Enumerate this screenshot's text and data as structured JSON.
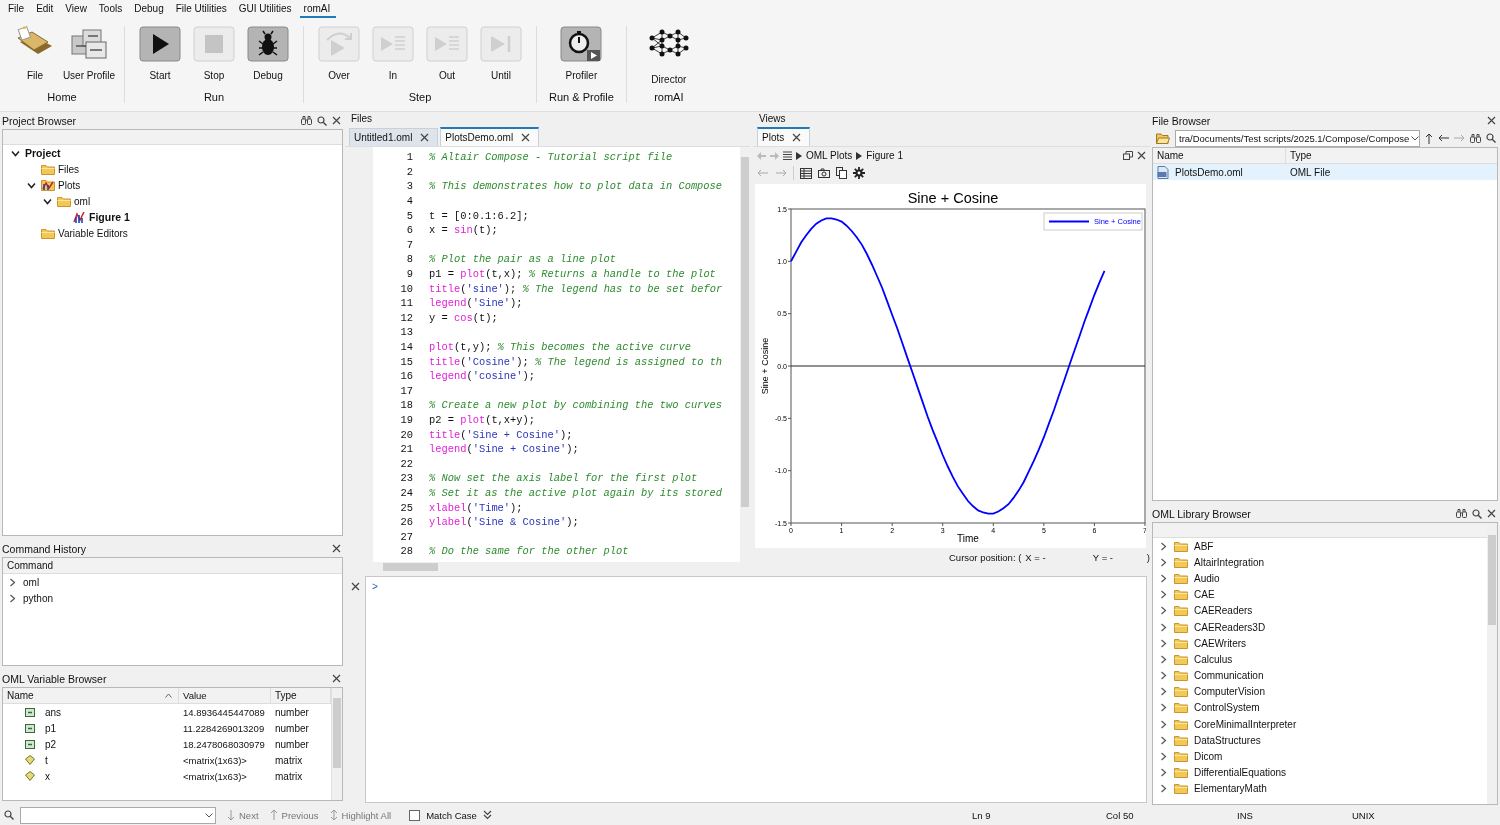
{
  "menu": [
    {
      "label": "File",
      "selected": false
    },
    {
      "label": "Edit",
      "selected": false
    },
    {
      "label": "View",
      "selected": false
    },
    {
      "label": "Tools",
      "selected": false
    },
    {
      "label": "Debug",
      "selected": false
    },
    {
      "label": "File Utilities",
      "selected": false
    },
    {
      "label": "GUI Utilities",
      "selected": false
    },
    {
      "label": "romAI",
      "selected": true
    }
  ],
  "ribbon": [
    {
      "label": "Home",
      "buttons": [
        {
          "label": "File",
          "kind": "file",
          "disabled": false
        },
        {
          "label": "User Profile",
          "kind": "profile",
          "disabled": false
        }
      ]
    },
    {
      "label": "Run",
      "buttons": [
        {
          "label": "Start",
          "kind": "start",
          "disabled": false
        },
        {
          "label": "Stop",
          "kind": "stop",
          "disabled": true
        },
        {
          "label": "Debug",
          "kind": "debug",
          "disabled": false
        }
      ]
    },
    {
      "label": "Step",
      "buttons": [
        {
          "label": "Over",
          "kind": "over",
          "disabled": true
        },
        {
          "label": "In",
          "kind": "in",
          "disabled": true
        },
        {
          "label": "Out",
          "kind": "out",
          "disabled": true
        },
        {
          "label": "Until",
          "kind": "until",
          "disabled": true
        }
      ]
    },
    {
      "label": "Run & Profile",
      "buttons": [
        {
          "label": "Profiler",
          "kind": "profiler",
          "disabled": false
        }
      ]
    },
    {
      "label": "romAI",
      "buttons": [
        {
          "label": "Director",
          "kind": "director",
          "disabled": false
        }
      ]
    }
  ],
  "project_browser": {
    "title": "Project Browser",
    "tree": [
      {
        "label": "Project",
        "kind": "root",
        "expanded": true,
        "children": [
          {
            "label": "Files",
            "kind": "folder"
          },
          {
            "label": "Plots",
            "kind": "plots",
            "expanded": true,
            "children": [
              {
                "label": "oml",
                "kind": "folder",
                "expanded": true,
                "children": [
                  {
                    "label": "Figure 1",
                    "kind": "figure"
                  }
                ]
              }
            ]
          },
          {
            "label": "Variable Editors",
            "kind": "folder"
          }
        ]
      }
    ]
  },
  "command_history": {
    "title": "Command History",
    "column": "Command",
    "items": [
      {
        "label": "oml",
        "expanded": false
      },
      {
        "label": "python",
        "expanded": false
      }
    ]
  },
  "variable_browser": {
    "title": "OML Variable Browser",
    "columns": [
      "Name",
      "Value",
      "Type"
    ],
    "rows": [
      {
        "name": "ans",
        "value": "14.8936445447089",
        "type": "number",
        "kind": "number"
      },
      {
        "name": "p1",
        "value": "11.2284269013209",
        "type": "number",
        "kind": "number"
      },
      {
        "name": "p2",
        "value": "18.2478068030979",
        "type": "number",
        "kind": "number"
      },
      {
        "name": "t",
        "value": "<matrix(1x63)>",
        "type": "matrix",
        "kind": "matrix"
      },
      {
        "name": "x",
        "value": "<matrix(1x63)>",
        "type": "matrix",
        "kind": "matrix"
      }
    ]
  },
  "editor": {
    "title": "Files",
    "tabs": [
      {
        "label": "Untitled1.oml",
        "selected": false
      },
      {
        "label": "PlotsDemo.oml",
        "selected": true
      }
    ],
    "lines": [
      {
        "number": "1",
        "segments": [
          {
            "text": "% Altair Compose - Tutorial script file",
            "kind": "comment"
          }
        ]
      },
      {
        "number": "2"
      },
      {
        "number": "3",
        "segments": [
          {
            "text": "% This demonstrates how to plot data in Compose",
            "kind": "comment"
          }
        ]
      },
      {
        "number": "4"
      },
      {
        "number": "5",
        "segments": [
          {
            "text": "t = [0:0.1:6.2];",
            "kind": "plain"
          }
        ]
      },
      {
        "number": "6",
        "segments": [
          {
            "text": "x = ",
            "kind": "plain"
          },
          {
            "text": "sin",
            "kind": "function"
          },
          {
            "text": "(t);",
            "kind": "plain"
          }
        ]
      },
      {
        "number": "7"
      },
      {
        "number": "8",
        "segments": [
          {
            "text": "% Plot the pair as a line plot",
            "kind": "comment"
          }
        ]
      },
      {
        "number": "9",
        "segments": [
          {
            "text": "p1 = ",
            "kind": "plain"
          },
          {
            "text": "plot",
            "kind": "function"
          },
          {
            "text": "(t,x); ",
            "kind": "plain"
          },
          {
            "text": "% Returns a handle to the plot",
            "kind": "comment"
          }
        ]
      },
      {
        "number": "10",
        "segments": [
          {
            "text": "title",
            "kind": "function"
          },
          {
            "text": "(",
            "kind": "plain"
          },
          {
            "text": "'sine'",
            "kind": "string"
          },
          {
            "text": "); ",
            "kind": "plain"
          },
          {
            "text": "% The legend has to be set befor",
            "kind": "comment"
          }
        ]
      },
      {
        "number": "11",
        "segments": [
          {
            "text": "legend",
            "kind": "function"
          },
          {
            "text": "(",
            "kind": "plain"
          },
          {
            "text": "'Sine'",
            "kind": "string"
          },
          {
            "text": ");",
            "kind": "plain"
          }
        ]
      },
      {
        "number": "12",
        "segments": [
          {
            "text": "y = ",
            "kind": "plain"
          },
          {
            "text": "cos",
            "kind": "function"
          },
          {
            "text": "(t);",
            "kind": "plain"
          }
        ]
      },
      {
        "number": "13"
      },
      {
        "number": "14",
        "segments": [
          {
            "text": "plot",
            "kind": "function"
          },
          {
            "text": "(t,y); ",
            "kind": "plain"
          },
          {
            "text": "% This becomes the active curve",
            "kind": "comment"
          }
        ]
      },
      {
        "number": "15",
        "segments": [
          {
            "text": "title",
            "kind": "function"
          },
          {
            "text": "(",
            "kind": "plain"
          },
          {
            "text": "'Cosine'",
            "kind": "string"
          },
          {
            "text": "); ",
            "kind": "plain"
          },
          {
            "text": "% The legend is assigned to th",
            "kind": "comment"
          }
        ]
      },
      {
        "number": "16",
        "segments": [
          {
            "text": "legend",
            "kind": "function"
          },
          {
            "text": "(",
            "kind": "plain"
          },
          {
            "text": "'cosine'",
            "kind": "string"
          },
          {
            "text": ");",
            "kind": "plain"
          }
        ]
      },
      {
        "number": "17"
      },
      {
        "number": "18",
        "segments": [
          {
            "text": "% Create a new plot by combining the two curves",
            "kind": "comment"
          }
        ]
      },
      {
        "number": "19",
        "segments": [
          {
            "text": "p2 = ",
            "kind": "plain"
          },
          {
            "text": "plot",
            "kind": "function"
          },
          {
            "text": "(t,x+y);",
            "kind": "plain"
          }
        ]
      },
      {
        "number": "20",
        "segments": [
          {
            "text": "title",
            "kind": "function"
          },
          {
            "text": "(",
            "kind": "plain"
          },
          {
            "text": "'Sine + Cosine'",
            "kind": "string"
          },
          {
            "text": ");",
            "kind": "plain"
          }
        ]
      },
      {
        "number": "21",
        "segments": [
          {
            "text": "legend",
            "kind": "function"
          },
          {
            "text": "(",
            "kind": "plain"
          },
          {
            "text": "'Sine + Cosine'",
            "kind": "string"
          },
          {
            "text": ");",
            "kind": "plain"
          }
        ]
      },
      {
        "number": "22"
      },
      {
        "number": "23",
        "segments": [
          {
            "text": "% Now set the axis label for the first plot",
            "kind": "comment"
          }
        ]
      },
      {
        "number": "24",
        "segments": [
          {
            "text": "% Set it as the active plot again by its stored",
            "kind": "comment"
          }
        ]
      },
      {
        "number": "25",
        "segments": [
          {
            "text": "xlabel",
            "kind": "function"
          },
          {
            "text": "(",
            "kind": "plain"
          },
          {
            "text": "'Time'",
            "kind": "string"
          },
          {
            "text": ");",
            "kind": "plain"
          }
        ]
      },
      {
        "number": "26",
        "segments": [
          {
            "text": "ylabel",
            "kind": "function"
          },
          {
            "text": "(",
            "kind": "plain"
          },
          {
            "text": "'Sine & Cosine'",
            "kind": "string"
          },
          {
            "text": ");",
            "kind": "plain"
          }
        ]
      },
      {
        "number": "27"
      },
      {
        "number": "28",
        "segments": [
          {
            "text": "% Do the same for the other plot",
            "kind": "comment"
          }
        ]
      }
    ]
  },
  "views": {
    "title": "Views",
    "tabs": [
      {
        "label": "Plots",
        "selected": true
      }
    ],
    "breadcrumb": [
      "OML Plots",
      "Figure 1"
    ],
    "chart_data": {
      "type": "line",
      "title": "Sine + Cosine",
      "xlabel": "Time",
      "ylabel": "Sine + Cosine",
      "x": [
        0,
        0.1,
        0.2,
        0.3,
        0.4,
        0.5,
        0.6,
        0.7,
        0.8,
        0.9,
        1,
        1.1,
        1.2,
        1.3,
        1.4,
        1.5,
        1.6,
        1.7,
        1.8,
        1.9,
        2,
        2.1,
        2.2,
        2.3,
        2.4,
        2.5,
        2.6,
        2.7,
        2.8,
        2.9,
        3,
        3.1,
        3.2,
        3.3,
        3.4,
        3.5,
        3.6,
        3.7,
        3.8,
        3.9,
        4,
        4.1,
        4.2,
        4.3,
        4.4,
        4.5,
        4.6,
        4.7,
        4.8,
        4.9,
        5,
        5.1,
        5.2,
        5.3,
        5.4,
        5.5,
        5.6,
        5.7,
        5.8,
        5.9,
        6,
        6.1,
        6.2
      ],
      "series": [
        {
          "name": "Sine + Cosine",
          "color": "#0000ff",
          "values": [
            1,
            1.09,
            1.18,
            1.25,
            1.31,
            1.36,
            1.39,
            1.41,
            1.41,
            1.4,
            1.38,
            1.34,
            1.29,
            1.23,
            1.16,
            1.07,
            0.97,
            0.86,
            0.75,
            0.62,
            0.49,
            0.36,
            0.22,
            0.08,
            -0.06,
            -0.2,
            -0.34,
            -0.48,
            -0.61,
            -0.73,
            -0.85,
            -0.96,
            -1.06,
            -1.15,
            -1.22,
            -1.29,
            -1.34,
            -1.38,
            -1.4,
            -1.41,
            -1.41,
            -1.39,
            -1.36,
            -1.32,
            -1.26,
            -1.19,
            -1.11,
            -1.01,
            -0.91,
            -0.8,
            -0.68,
            -0.55,
            -0.42,
            -0.28,
            -0.14,
            0,
            0.14,
            0.28,
            0.42,
            0.55,
            0.68,
            0.8,
            0.91
          ]
        }
      ],
      "xlim": [
        0,
        7
      ],
      "ylim": [
        -1.5,
        1.5
      ],
      "xticks": [
        0,
        1,
        2,
        3,
        4,
        5,
        6,
        7
      ],
      "yticks": [
        {
          "value": -1.5,
          "label": "-1.5"
        },
        {
          "value": -1,
          "label": "-1.0"
        },
        {
          "value": -0.5,
          "label": "-0.5"
        },
        {
          "value": 0,
          "label": "0.0"
        },
        {
          "value": 0.5,
          "label": "0.5"
        },
        {
          "value": 1,
          "label": "1.0"
        },
        {
          "value": 1.5,
          "label": "1.5"
        }
      ]
    },
    "cursor": {
      "label": "Cursor position: (",
      "x": "X = -",
      "y": "Y = -",
      "end": ")"
    }
  },
  "console": {
    "prompt": ">"
  },
  "file_browser": {
    "title": "File Browser",
    "path": "tra/Documents/Test scripts/2025.1/Compose/Compose",
    "columns": [
      "Name",
      "Type"
    ],
    "rows": [
      {
        "name": "PlotsDemo.oml",
        "type": "OML File",
        "selected": true
      }
    ]
  },
  "library": {
    "title": "OML Library Browser",
    "items": [
      {
        "label": "ABF",
        "expanded": false
      },
      {
        "label": "AltairIntegration",
        "expanded": false
      },
      {
        "label": "Audio",
        "expanded": false
      },
      {
        "label": "CAE",
        "expanded": false
      },
      {
        "label": "CAEReaders",
        "expanded": false
      },
      {
        "label": "CAEReaders3D",
        "expanded": false
      },
      {
        "label": "CAEWriters",
        "expanded": false
      },
      {
        "label": "Calculus",
        "expanded": false
      },
      {
        "label": "Communication",
        "expanded": false
      },
      {
        "label": "ComputerVision",
        "expanded": false
      },
      {
        "label": "ControlSystem",
        "expanded": false
      },
      {
        "label": "CoreMinimalInterpreter",
        "expanded": false
      },
      {
        "label": "DataStructures",
        "expanded": false
      },
      {
        "label": "Dicom",
        "expanded": false
      },
      {
        "label": "DifferentialEquations",
        "expanded": false
      },
      {
        "label": "ElementaryMath",
        "expanded": false
      }
    ]
  },
  "find_bar": {
    "buttons": [
      {
        "label": "Next",
        "kind": "down",
        "disabled": true
      },
      {
        "label": "Previous",
        "kind": "up",
        "disabled": true
      },
      {
        "label": "Highlight All",
        "kind": "updown",
        "disabled": true
      }
    ],
    "match_case": {
      "label": "Match Case",
      "checked": false
    }
  },
  "status": {
    "line": "Ln 9",
    "column": "Col 50",
    "mode": "INS",
    "eol": "UNIX"
  }
}
